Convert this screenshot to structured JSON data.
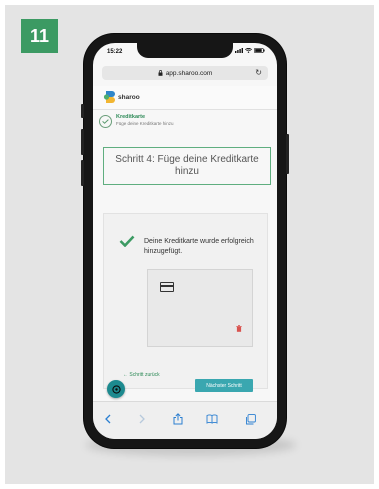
{
  "badge": {
    "number": "11"
  },
  "status_bar": {
    "time": "15:22"
  },
  "browser": {
    "url": "app.sharoo.com"
  },
  "app": {
    "logo_text": "sharoo"
  },
  "progress": {
    "step_title": "Kreditkarte",
    "step_subtitle": "Füge deine Kreditkarte hinzu"
  },
  "main": {
    "headline": "Schritt 4: Füge deine Kreditkarte hinzu",
    "success_message": "Deine Kreditkarte wurde erfolgreich hinzugefügt.",
    "back_link": "← Schritt zurück",
    "next_button": "Nächster Schritt"
  },
  "colors": {
    "accent_green": "#3c9a63",
    "button_teal": "#3aa7b0",
    "fab_teal": "#1d8a8f",
    "delete_red": "#d9534f"
  }
}
